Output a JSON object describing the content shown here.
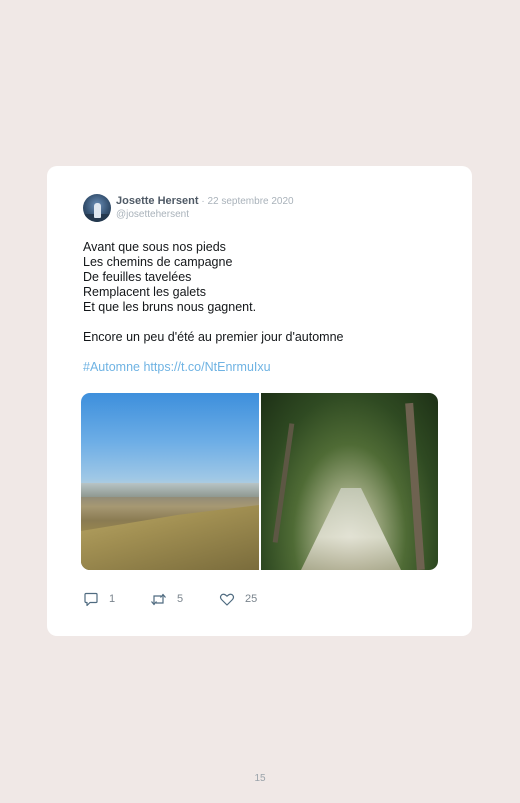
{
  "tweet": {
    "author_name": "Josette Hersent",
    "separator": " · ",
    "date": "22 septembre 2020",
    "handle": "@josettehersent",
    "poem_lines": [
      "Avant que sous nos pieds",
      "Les chemins de campagne",
      "De feuilles tavelées",
      "Remplacent les galets",
      "Et que les bruns nous gagnent."
    ],
    "closing_line": "Encore un peu d'été au premier jour d'automne",
    "hashtag": "#Automne",
    "link": "https://t.co/NtEnrmuIxu",
    "actions": {
      "replies": "1",
      "retweets": "5",
      "likes": "25"
    }
  },
  "page": {
    "number": "15"
  },
  "icons": {
    "reply": "reply-icon",
    "retweet": "retweet-icon",
    "like": "heart-icon"
  },
  "colors": {
    "background": "#f0e8e6",
    "card": "#ffffff",
    "link": "#6fb3e3",
    "muted": "#a9b2ba"
  }
}
